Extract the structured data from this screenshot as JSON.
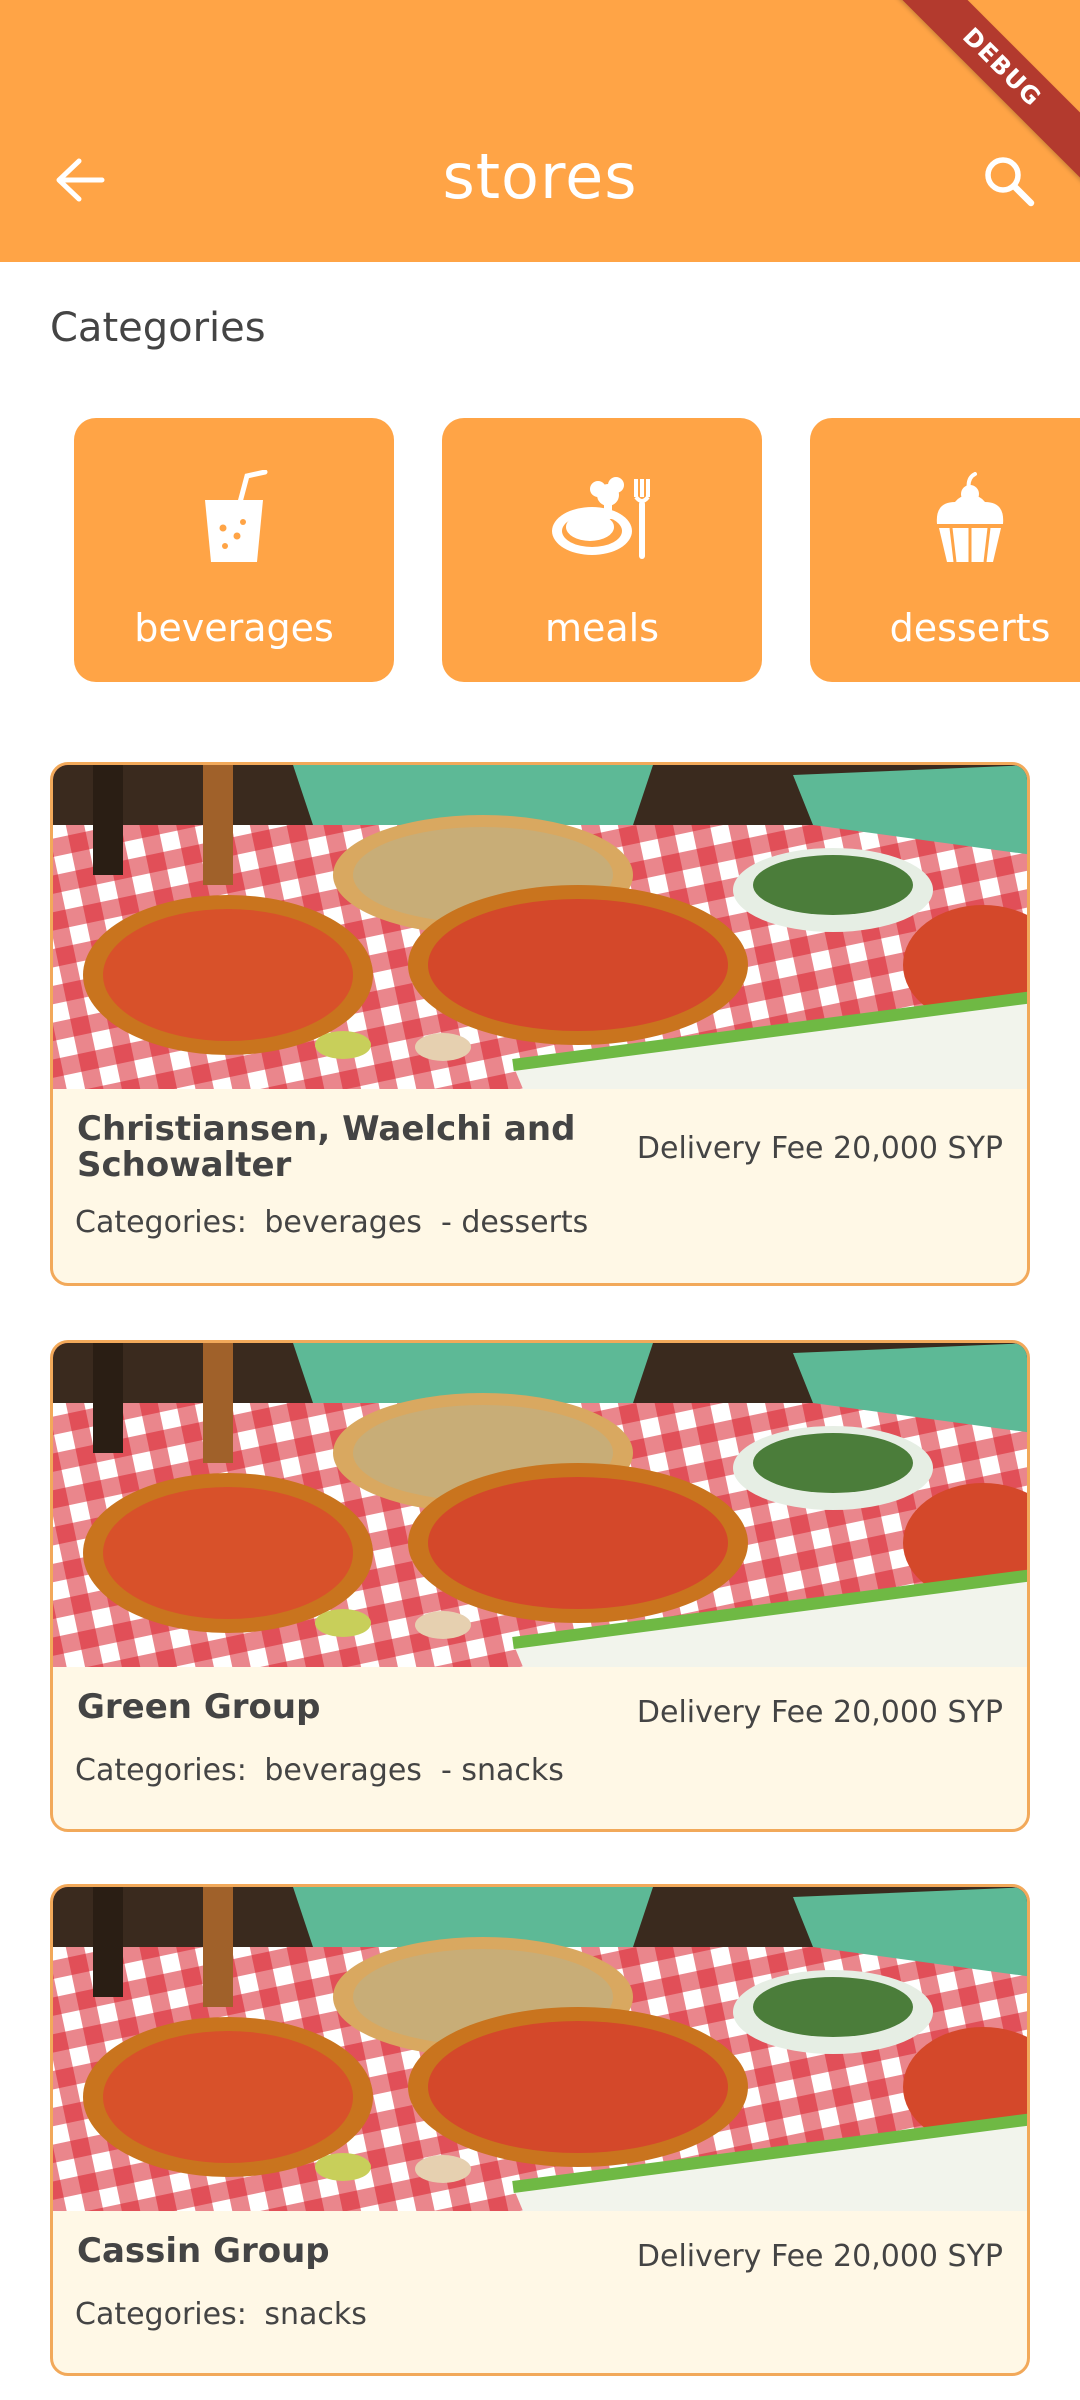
{
  "app_bar": {
    "title": "stores",
    "back_icon": "arrow-left-icon",
    "search_icon": "search-icon",
    "debug_label": "DEBUG",
    "color": "#FFA446"
  },
  "categories_section": {
    "title": "Categories",
    "items": [
      {
        "label": "beverages",
        "icon": "drink-icon"
      },
      {
        "label": "meals",
        "icon": "meal-icon"
      },
      {
        "label": "desserts",
        "icon": "cupcake-icon"
      }
    ]
  },
  "stores": [
    {
      "name": "Christiansen, Waelchi and Schowalter",
      "fee": "Delivery Fee 20,000 SYP",
      "categories_label": "Categories:",
      "categories": "beverages  - desserts"
    },
    {
      "name": "Green Group",
      "fee": "Delivery Fee 20,000 SYP",
      "categories_label": "Categories:",
      "categories": "beverages  - snacks"
    },
    {
      "name": "Cassin Group",
      "fee": "Delivery Fee 20,000 SYP",
      "categories_label": "Categories:",
      "categories": "snacks"
    }
  ],
  "colors": {
    "accent": "#FFA446",
    "card_bg": "#FFF8E6",
    "card_border": "#F2A95A",
    "ribbon": "#B33A2E"
  }
}
